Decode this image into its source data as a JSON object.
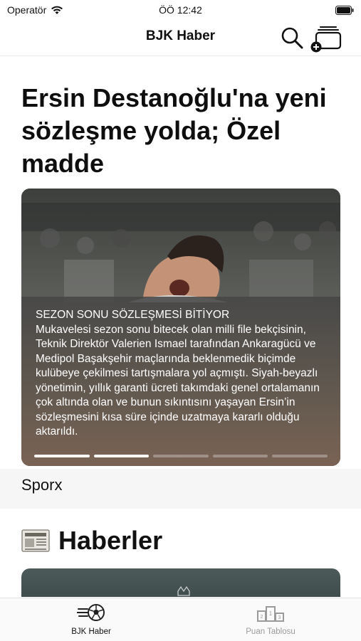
{
  "status_bar": {
    "carrier": "Operatör",
    "time": "ÖÖ 12:42"
  },
  "nav": {
    "title": "BJK Haber",
    "search_icon": "search-icon",
    "action_icon": "add-tab-icon"
  },
  "article": {
    "headline": "Ersin Destanoğlu'na yeni sözleşme yolda; Özel madde",
    "kicker": "SEZON SONU SÖZLEŞMESİ BİTİYOR",
    "summary": "Mukavelesi sezon sonu bitecek olan milli file bekçisinin, Teknik Direktör Valerien Ismael tarafından Ankaragücü ve Medipol Başakşehir maçlarında beklenmedik biçimde kulübeye çekilmesi tartışmalara yol açmıştı. Siyah-beyazlı yönetimin, yıllık garanti ücreti takımdaki genel ortalamanın çok altında olan ve bunun sıkıntısını yaşayan Ersin’in sözleşmesini kısa süre içinde uzatmaya kararlı olduğu aktarıldı.",
    "source": "Sporx",
    "progress": {
      "total": 5,
      "active": 1
    }
  },
  "section": {
    "title": "Haberler",
    "icon": "newspaper-icon"
  },
  "tabbar": {
    "tabs": [
      {
        "label": "BJK Haber",
        "icon": "football-icon",
        "active": true
      },
      {
        "label": "Puan Tablosu",
        "icon": "podium-icon",
        "active": false
      }
    ]
  },
  "colors": {
    "accent": "#111111",
    "inactive": "#9a9a9a"
  }
}
